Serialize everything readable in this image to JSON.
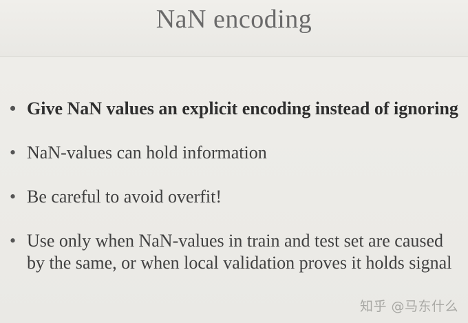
{
  "slide": {
    "title": "NaN encoding",
    "bullets": [
      {
        "text": "Give NaN values an explicit encoding instead of ignoring",
        "bold": true
      },
      {
        "text": "NaN-values can hold information",
        "bold": false
      },
      {
        "text": "Be careful to avoid overfit!",
        "bold": false
      },
      {
        "text": "Use only when NaN-values in train and test set are caused by the same, or when local validation proves it holds signal",
        "bold": false
      }
    ],
    "bullet_symbol": "•"
  },
  "watermark": "知乎 @马东什么"
}
